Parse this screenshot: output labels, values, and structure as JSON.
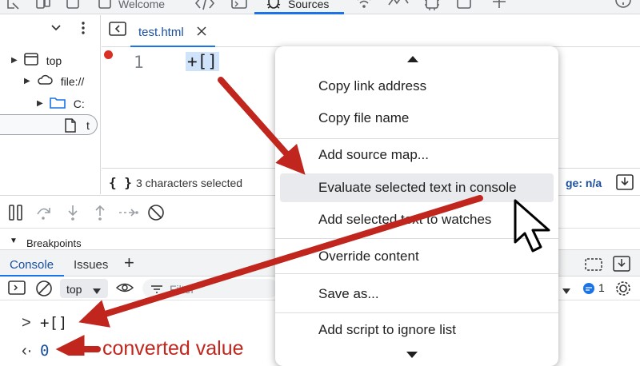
{
  "topbar": {
    "tabs": [
      {
        "label": "Welcome"
      },
      {
        "label": "Sources",
        "active": true
      }
    ]
  },
  "navigator": {
    "items": [
      {
        "label": "top"
      },
      {
        "label": "file://"
      },
      {
        "label": "C:"
      },
      {
        "label": "t"
      }
    ]
  },
  "editor": {
    "tab_label": "test.html",
    "line_number": "1",
    "code": "+[]"
  },
  "statusbar": {
    "braces": "{ }",
    "selection_text": "3 characters selected",
    "coverage_text": "ge: n/a"
  },
  "breakpoints": {
    "header": "Breakpoints"
  },
  "console_tabs": {
    "console_label": "Console",
    "issues_label": "Issues",
    "add_label": "+"
  },
  "console_toolbar": {
    "context_label": "top",
    "filter_placeholder": "Filter",
    "issues_count": "1"
  },
  "console_body": {
    "input_prompt": ">",
    "input_text": "+[]",
    "result_prompt": "‹·",
    "result_value": "0",
    "annotation": "converted value"
  },
  "context_menu": {
    "items": [
      {
        "label": "Copy link address"
      },
      {
        "label": "Copy file name"
      },
      {
        "label": "Add source map..."
      },
      {
        "label": "Evaluate selected text in console",
        "highlighted": true
      },
      {
        "label": "Add selected text to watches"
      },
      {
        "label": "Override content"
      },
      {
        "label": "Save as..."
      },
      {
        "label": "Add script to ignore list"
      }
    ]
  },
  "colors": {
    "accent": "#1a73e8",
    "annotation_red": "#c0261d",
    "breakpoint_red": "#d93025",
    "selection": "#cfe3fb"
  }
}
